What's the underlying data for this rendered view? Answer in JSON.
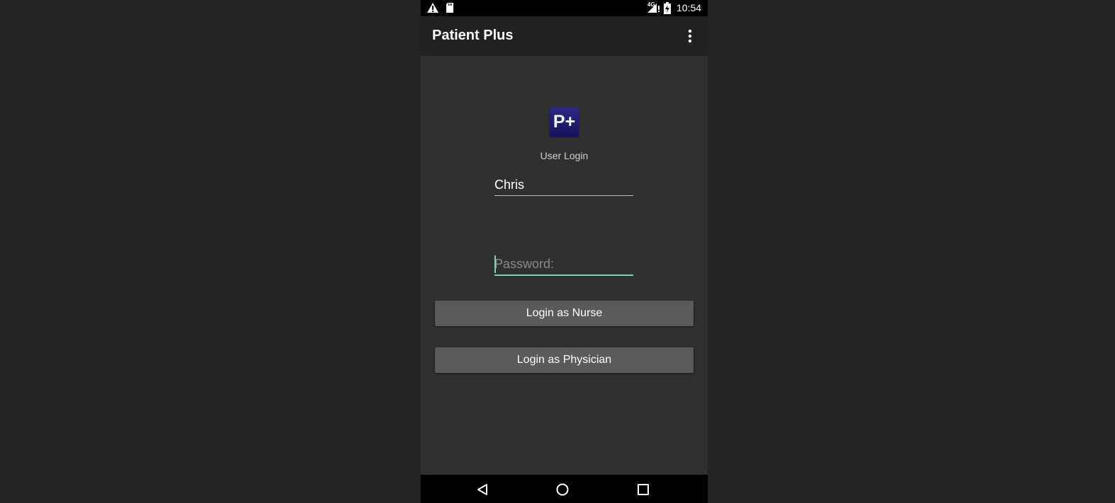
{
  "status_bar": {
    "time": "10:54",
    "network": "4G",
    "icons": [
      "warning-icon",
      "sd-card-icon",
      "signal-icon",
      "battery-charging-icon"
    ]
  },
  "app_bar": {
    "title": "Patient Plus",
    "overflow_icon": "more-vert-icon"
  },
  "login": {
    "logo_text": "P+",
    "heading": "User Login",
    "username_value": "Chris",
    "password_placeholder": "Password:",
    "nurse_button": "Login as Nurse",
    "physician_button": "Login as Physician"
  },
  "nav_bar": {
    "icons": [
      "back-icon",
      "home-icon",
      "recents-icon"
    ]
  },
  "colors": {
    "screen_background": "#303030",
    "app_bar": "#212121",
    "accent": "#80cbc4",
    "button": "#5a5a5a",
    "logo": "#1e1e6e"
  }
}
